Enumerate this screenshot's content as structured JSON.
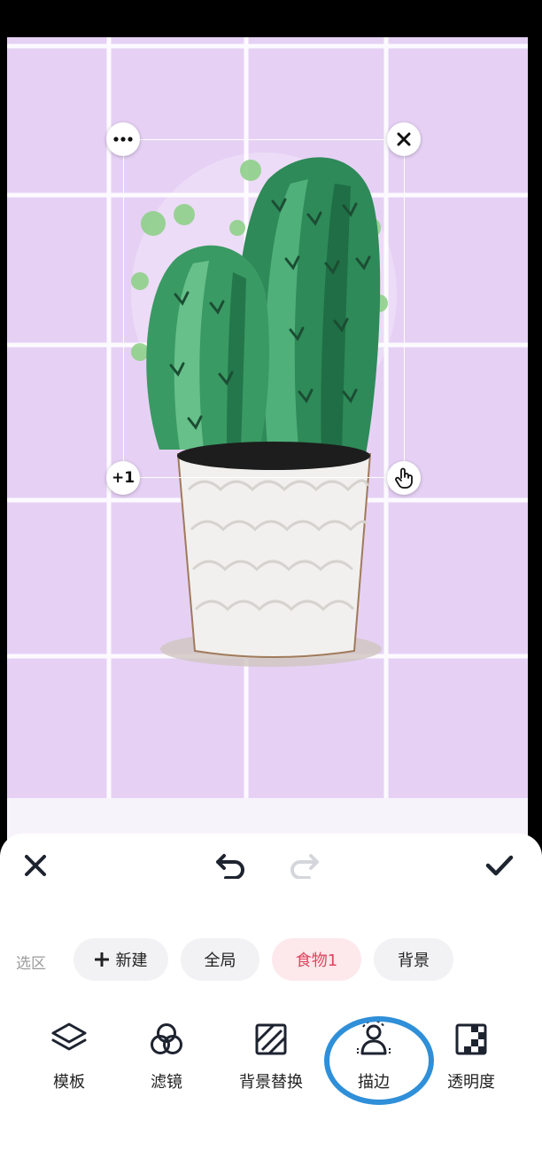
{
  "canvas": {
    "background_color": "#e6d1f5",
    "grid_line_color": "#ffffff",
    "subject": "cactus-in-pot"
  },
  "selection": {
    "more_icon": "more-horizontal-icon",
    "close_icon": "close-icon",
    "duplicate_label": "+1",
    "gesture_icon": "hand-pointer-icon"
  },
  "toolbar": {
    "close_icon": "close-icon",
    "undo_icon": "undo-icon",
    "redo_icon": "redo-icon",
    "confirm_icon": "check-icon"
  },
  "selection_chips": {
    "label": "选区",
    "items": [
      {
        "label": "新建",
        "icon": "plus-icon",
        "active": false
      },
      {
        "label": "全局",
        "active": false
      },
      {
        "label": "食物1",
        "active": true
      },
      {
        "label": "背景",
        "active": false
      }
    ],
    "active_color": "#e0455e"
  },
  "tools": [
    {
      "label": "模板",
      "icon": "layers-icon"
    },
    {
      "label": "滤镜",
      "icon": "filter-circles-icon"
    },
    {
      "label": "背景替换",
      "icon": "hatch-square-icon"
    },
    {
      "label": "描边",
      "icon": "person-outline-icon",
      "highlighted": true
    },
    {
      "label": "透明度",
      "icon": "checkerboard-icon"
    }
  ],
  "highlight_color": "#2f8fd8"
}
